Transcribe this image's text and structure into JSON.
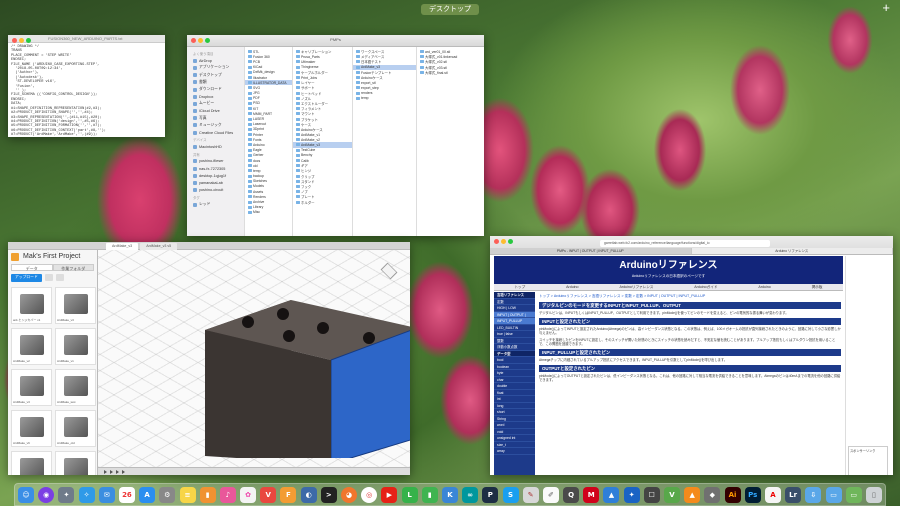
{
  "top_bar": {
    "desktop_label": "デスクトップ",
    "add_space": "+"
  },
  "code_window": {
    "title": "FUSION360_NEW_ARDUINO_PARTS.txt",
    "lines": [
      "/* DRAWING */",
      "TRANS",
      "PLACE_COMMENT = 'STEP WRITE'",
      "ENDSEC;",
      "FILE_NAME ('ARDUINO_CASE_EXPORTING.STEP',",
      "  '2018-05-08T09:12:34',",
      "  ('Author'),",
      "  ('Autodesk'),",
      "  'ST-DEVELOPER v16',",
      "  'Fusion',",
      "  '' );",
      "FILE_SCHEMA (('CONFIG_CONTROL_DESIGN'));",
      "ENDSEC;",
      "",
      "DATA;",
      "#1=SHAPE_DEFINITION_REPRESENTATION(#2,#3);",
      "#2=PRODUCT_DEFINITION_SHAPE('','',#4);",
      "#3=SHAPE_REPRESENTATION('',(#11,#15),#20);",
      "#4=PRODUCT_DEFINITION('design','',#5,#6);",
      "#5=PRODUCT_DEFINITION_FORMATION('','',#7);",
      "#6=PRODUCT_DEFINITION_CONTEXT('part',#8,'');",
      "#7=PRODUCT('ArdMake','ArdMake','',(#9));",
      "#8=APPLICATION_CONTEXT('design');",
      "#9=PRODUCT_CONTEXT('',#8,'mechanical');",
      "#10=CARTESIAN_POINT('',(0.,0.,0.));",
      "#11=AXIS2_PLACEMENT_3D('',#10,#12,#13);",
      "#12=DIRECTION('',(0.,0.,1.));",
      "#13=DIRECTION('',(1.,0.,0.));",
      "#14=CARTESIAN_POINT('',(12.7,0.,0.));",
      "#15=ADVANCED_BREP_SHAPE_REPRESENTATION();"
    ]
  },
  "finder": {
    "title": "PMPs",
    "sidebar": [
      {
        "label": "よく使う項目",
        "head": true
      },
      {
        "label": "AirDrop"
      },
      {
        "label": "アプリケーション"
      },
      {
        "label": "デスクトップ"
      },
      {
        "label": "書類"
      },
      {
        "label": "ダウンロード"
      },
      {
        "label": "Dropbox"
      },
      {
        "label": "ムービー"
      },
      {
        "label": "iCloud Drive"
      },
      {
        "label": "写真"
      },
      {
        "label": "ミュージック"
      },
      {
        "label": "Creative Cloud Files"
      },
      {
        "label": "デバイス",
        "head": true
      },
      {
        "label": "MacintoshHD"
      },
      {
        "label": "共有",
        "head": true
      },
      {
        "label": "yoshino-fileser"
      },
      {
        "label": "nas-fx-7272305"
      },
      {
        "label": "desktop-1qjug1f"
      },
      {
        "label": "yamanakaLab"
      },
      {
        "label": "yoshino-circuit"
      },
      {
        "label": "タグ",
        "head": true
      },
      {
        "label": "レッド"
      }
    ],
    "col1": [
      "STL",
      "Fusion 360",
      "PCB",
      "KiCad",
      "DxfMk_design",
      "Illustrator",
      "ILLUSTRATOR_DATA",
      "SVG",
      "JPG",
      "PDF",
      "PSD",
      "KIT",
      "MMM_PART",
      "LASER",
      "Lasercut",
      "3Dprint",
      "Printer",
      "Fonts",
      "Arduino",
      "Eagle",
      "Gerber",
      "docs",
      "old",
      "temp",
      "backup",
      "Sketches",
      "Models",
      "Assets",
      "Renders",
      "Archive",
      "Library",
      "Misc"
    ],
    "col2": [
      "キャリブレーション",
      "Prusa_Parts",
      "Ultimaker",
      "Thingiverse",
      "ケーブルホルダー",
      "Print_Jobs",
      "レイヤー",
      "サポート",
      "ヒートベッド",
      "ノズル",
      "エクストルーダー",
      "フィラメント",
      "マウント",
      "ブラケット",
      "ケース",
      "Arduinoケース",
      "ArdMake_v1",
      "ArdMake_v2",
      "ArdMake_v3",
      "TestCube",
      "Benchy",
      "Calib",
      "ギア",
      "ヒンジ",
      "クリップ",
      "スタンド",
      "フック",
      "ノブ",
      "プレート",
      "ホルダー"
    ],
    "col3": [
      "ワークスペース",
      "メディアベース",
      "日本語テスト",
      "ArdMake_v3",
      "Fusionテンプレート",
      "Arduinoケース",
      "export_stl",
      "export_step",
      "renders",
      "temp"
    ],
    "col4": [
      "ard_ver01_00.stl",
      "大塚式_v01.tinkercad",
      "大塚式_v02.stl",
      "大塚式_v03.stl",
      "大塚式_final.stl"
    ]
  },
  "fusion": {
    "project_title": "Mak's First Project",
    "panel_tabs": [
      "データ",
      "作業フォルダ"
    ],
    "upload_label": "アップロード",
    "doc_tabs": [
      "ArdMake_v3",
      "ArdMake_v3 v5"
    ],
    "thumbs": [
      "ard-ヒンジカバー v1",
      "ArdMake_v3",
      "ArdMake_v2",
      "ArdMake_v1",
      "ArdMake_v3",
      "ArdMake_test",
      "ArdMake_v6",
      "ArdMake_old",
      "ArdMake_v4",
      "ArdMake_v7"
    ]
  },
  "safari": {
    "url": "garretlab.web.fc2.com/arduino_reference/language/functions/digital_io",
    "tabs": [
      "PMPs - INPUT | OUTPUT | INPUT_PULLUP",
      "Arduino リファレンス"
    ],
    "site_title": "Arduinoリファレンス",
    "site_subtitle": "Arduinoリファレンスの日本語訳のページです",
    "nav": [
      "トップ",
      "Arduino",
      "Arduinoリファレンス",
      "Arduinoガイド",
      "Arduino",
      "掲示板"
    ],
    "left_menu": [
      {
        "label": "言語リファレンス",
        "cls": "cat"
      },
      {
        "label": "定数"
      },
      {
        "label": "HIGH | LOW"
      },
      {
        "label": "INPUT | OUTPUT |",
        "cls": "hl"
      },
      {
        "label": "INPUT_PULLUP",
        "cls": "hl"
      },
      {
        "label": "LED_BUILTIN"
      },
      {
        "label": "true | false"
      },
      {
        "label": "整数"
      },
      {
        "label": "浮動小数点数"
      },
      {
        "label": "データ型",
        "cls": "cat"
      },
      {
        "label": "bool"
      },
      {
        "label": "boolean"
      },
      {
        "label": "byte"
      },
      {
        "label": "char"
      },
      {
        "label": "double"
      },
      {
        "label": "float"
      },
      {
        "label": "int"
      },
      {
        "label": "long"
      },
      {
        "label": "short"
      },
      {
        "label": "String"
      },
      {
        "label": "word"
      },
      {
        "label": "void"
      },
      {
        "label": "unsigned int"
      },
      {
        "label": "size_t"
      },
      {
        "label": "array"
      }
    ],
    "breadcrumb": "トップ > Arduinoリファレンス > 言語リファレンス > 変数 > 定数 > INPUT | OUTPUT | INPUT_PULLUP",
    "h1": "デジタルピンのモードを変更するINPUTとINPUT_PULLUP、OUTPUT",
    "p1": "デジタルピンは、INPUTもしくはINPUT_PULLUP、OUTPUTとして利用できます。pinMode()を使ってピンのモードを変えると、ピンの電気的な振る舞いが変わります。",
    "h2": "INPUTと設定されたピン",
    "p2": "pinMode()によってINPUTと設定されたArduino(Atmega)のピンは、高インピーダンス状態となる。この状態は、例えば、100メガオームの抵抗が直列接続されたときのように、回路に対して小さな影響しか与えません。",
    "p3": "スイッチを接続したピンをINPUTに設定し、そのスイッチが開いた状態のときにスイッチの状態を読みだすと、不安定な値を読むことがあります。プルアップ抵抗もしくはプルダウン抵抗を用いることで、この問題を回避できます。",
    "h3": "INPUT_PULLUPと設定されたピン",
    "p4": "Atmegaチップに内蔵されているプルアップ抵抗にアクセスできます。INPUT_PULLUPを引数としてpinMode()を呼び出します。",
    "h4": "OUTPUTと設定されたピン",
    "p5": "pinMode()によってOUTPUTと設定されたピンは、低インピーダンス状態となる。これは、他の回路に対して相当な電流を供給できることを意味します。Atmegaのピンは40mAまでの電流を他の回路に供給できます。",
    "ad_title": "スポンサーリンク"
  },
  "dock": [
    {
      "name": "finder-icon",
      "bg": "#3a8ee6",
      "glyph": "☺"
    },
    {
      "name": "siri-icon",
      "bg": "#7b3fe4",
      "glyph": "◉"
    },
    {
      "name": "launchpad-icon",
      "bg": "#6f7b8a",
      "glyph": "✦"
    },
    {
      "name": "safari-icon",
      "bg": "#2f9ae8",
      "glyph": "✧"
    },
    {
      "name": "mail-icon",
      "bg": "#3b8ee0",
      "glyph": "✉"
    },
    {
      "name": "calendar-icon",
      "bg": "#ffffff",
      "glyph": "26",
      "fg": "#e33"
    },
    {
      "name": "appstore-icon",
      "bg": "#2a8ef0",
      "glyph": "A"
    },
    {
      "name": "preferences-icon",
      "bg": "#888888",
      "glyph": "⚙"
    },
    {
      "name": "notes-icon",
      "bg": "#f7d547",
      "glyph": "≡"
    },
    {
      "name": "books-icon",
      "bg": "#f09232",
      "glyph": "▮"
    },
    {
      "name": "itunes-icon",
      "bg": "#e9579a",
      "glyph": "♪"
    },
    {
      "name": "photos-icon",
      "bg": "#f4f4f4",
      "glyph": "✿",
      "fg": "#e4a"
    },
    {
      "name": "vivaldi-icon",
      "bg": "#e9473f",
      "glyph": "V"
    },
    {
      "name": "fusion360-icon",
      "bg": "#f39c33",
      "glyph": "F"
    },
    {
      "name": "blender-icon",
      "bg": "#3d6aa8",
      "glyph": "◐"
    },
    {
      "name": "terminal-icon",
      "bg": "#222222",
      "glyph": ">"
    },
    {
      "name": "firefox-icon",
      "bg": "#f0762e",
      "glyph": "◕"
    },
    {
      "name": "chrome-icon",
      "bg": "#ffffff",
      "glyph": "◎",
      "fg": "#d33"
    },
    {
      "name": "youtube-icon",
      "bg": "#e62117",
      "glyph": "▶"
    },
    {
      "name": "line-icon",
      "bg": "#36b24a",
      "glyph": "L"
    },
    {
      "name": "numbers-icon",
      "bg": "#3fb450",
      "glyph": "▮"
    },
    {
      "name": "keynote-icon",
      "bg": "#3a86d6",
      "glyph": "K"
    },
    {
      "name": "arduino-icon",
      "bg": "#00979d",
      "glyph": "∞"
    },
    {
      "name": "processing-icon",
      "bg": "#1d2d44",
      "glyph": "P"
    },
    {
      "name": "skype-icon",
      "bg": "#1a9ff0",
      "glyph": "S"
    },
    {
      "name": "paint-brush-icon",
      "bg": "#d8d8d8",
      "glyph": "✎",
      "fg": "#a33"
    },
    {
      "name": "textedit-icon",
      "bg": "#fafafa",
      "glyph": "✐",
      "fg": "#555"
    },
    {
      "name": "quicktime-icon",
      "bg": "#4a4a4a",
      "glyph": "Q"
    },
    {
      "name": "makerbot-icon",
      "bg": "#d0021b",
      "glyph": "M"
    },
    {
      "name": "cura-icon",
      "bg": "#2f7fd8",
      "glyph": "▲"
    },
    {
      "name": "sourcetree-icon",
      "bg": "#1a63c4",
      "glyph": "✦"
    },
    {
      "name": "fritzing-icon",
      "bg": "#444444",
      "glyph": "☐"
    },
    {
      "name": "vectorworks-icon",
      "bg": "#58a84a",
      "glyph": "V"
    },
    {
      "name": "vlc-icon",
      "bg": "#f48a1c",
      "glyph": "▲"
    },
    {
      "name": "maker-icon",
      "bg": "#707070",
      "glyph": "◆"
    },
    {
      "name": "illustrator-icon",
      "bg": "#330000",
      "glyph": "Ai",
      "fg": "#ff9a00"
    },
    {
      "name": "photoshop-icon",
      "bg": "#001d34",
      "glyph": "Ps",
      "fg": "#31a8ff"
    },
    {
      "name": "acrobat-icon",
      "bg": "#f5f5f5",
      "glyph": "A",
      "fg": "#e00"
    },
    {
      "name": "lightroom-icon",
      "bg": "#3a4f6a",
      "glyph": "Lr"
    },
    {
      "name": "downloads-folder-icon",
      "bg": "#5aa7e8",
      "glyph": "⇩"
    },
    {
      "name": "documents-folder-icon",
      "bg": "#5aa7e8",
      "glyph": "▭"
    },
    {
      "name": "folder-icon",
      "bg": "#6fb65b",
      "glyph": "▭"
    },
    {
      "name": "trash-icon",
      "bg": "#cfd3d6",
      "glyph": "▯",
      "fg": "#666"
    }
  ]
}
